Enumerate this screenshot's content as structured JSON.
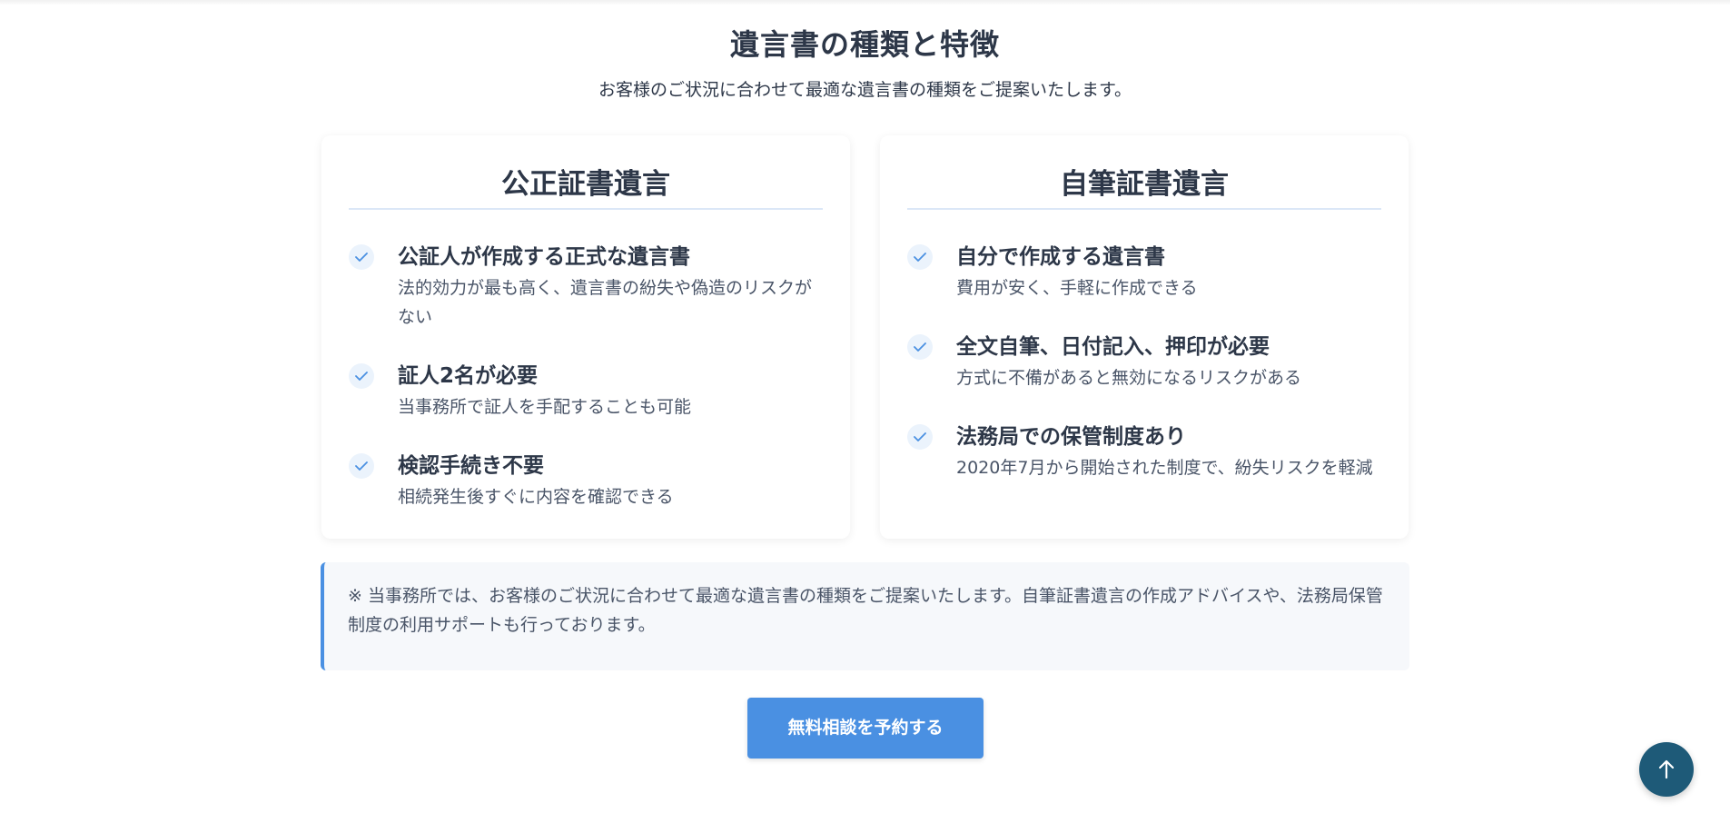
{
  "section": {
    "title": "遺言書の種類と特徴",
    "lead": "お客様のご状況に合わせて最適な遺言書の種類をご提案いたします。"
  },
  "cards": [
    {
      "title": "公正証書遺言",
      "features": [
        {
          "icon": "check-icon",
          "title": "公証人が作成する正式な遺言書",
          "desc": "法的効力が最も高く、遺言書の紛失や偽造のリスクがない"
        },
        {
          "icon": "check-icon",
          "title": "証人2名が必要",
          "desc": "当事務所で証人を手配することも可能"
        },
        {
          "icon": "check-icon",
          "title": "検認手続き不要",
          "desc": "相続発生後すぐに内容を確認できる"
        }
      ]
    },
    {
      "title": "自筆証書遺言",
      "features": [
        {
          "icon": "check-icon",
          "title": "自分で作成する遺言書",
          "desc": "費用が安く、手軽に作成できる"
        },
        {
          "icon": "check-icon",
          "title": "全文自筆、日付記入、押印が必要",
          "desc": "方式に不備があると無効になるリスクがある"
        },
        {
          "icon": "check-icon",
          "title": "法務局での保管制度あり",
          "desc": "2020年7月から開始された制度で、紛失リスクを軽減"
        }
      ]
    }
  ],
  "note": {
    "text": "※ 当事務所では、お客様のご状況に合わせて最適な遺言書の種類をご提案いたします。自筆証書遺言の作成アドバイスや、法務局保管制度の利用サポートも行っております。"
  },
  "cta": {
    "label": "無料相談を予約する"
  },
  "back_to_top": {
    "icon": "arrow-up-icon"
  },
  "colors": {
    "accent": "#4a90e2",
    "back_to_top": "#1e5a78",
    "text": "#2d3748"
  }
}
